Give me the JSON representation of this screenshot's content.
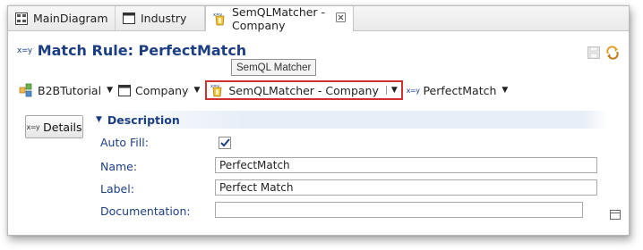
{
  "tabs": [
    {
      "label": "MainDiagram",
      "icon": "diagram-icon"
    },
    {
      "label": "Industry",
      "icon": "window-icon"
    },
    {
      "label": "SemQLMatcher - Company",
      "icon": "matcher-icon",
      "active": true,
      "close": "close-icon"
    }
  ],
  "header": {
    "prefix": "x=y",
    "title": "Match Rule: PerfectMatch",
    "tooltip": "SemQL Matcher"
  },
  "breadcrumb": [
    {
      "label": "B2BTutorial",
      "icon": "model-icon"
    },
    {
      "label": "Company",
      "icon": "window-icon"
    },
    {
      "label": "SemQLMatcher - Company",
      "icon": "matcher-icon",
      "highlighted": true
    },
    {
      "label": "PerfectMatch",
      "icon": "xy-icon",
      "prefix": "x=y"
    }
  ],
  "details_button": {
    "label": "Details",
    "prefix": "x=y"
  },
  "section": {
    "title": "Description"
  },
  "fields": {
    "auto_fill": {
      "label": "Auto Fill:",
      "checked": true
    },
    "name": {
      "label": "Name:",
      "value": "PerfectMatch"
    },
    "label": {
      "label": "Label:",
      "value": "Perfect Match"
    },
    "documentation": {
      "label": "Documentation:",
      "value": ""
    }
  },
  "colors": {
    "accent": "#1c3f84",
    "highlight": "#d0312d"
  }
}
